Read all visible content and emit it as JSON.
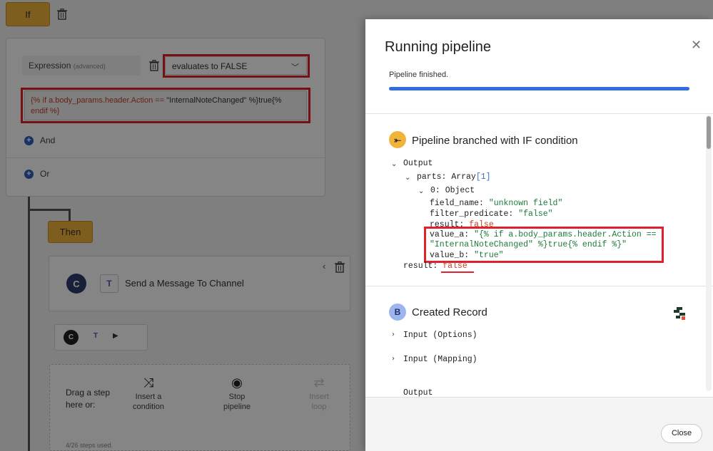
{
  "editor": {
    "if_label": "If",
    "then_label": "Then",
    "expression_label": "Expression",
    "expression_hint": "(advanced)",
    "condition_select": "evaluates to FALSE",
    "expression_code_prefix": "{% if a.body_params.header.Action == ",
    "expression_code_literal": "\"InternalNoteChanged\"",
    "expression_code_suffix": " %}true{%",
    "expression_code_line2": "endif %}",
    "and_label": "And",
    "or_label": "Or",
    "step_avatar": "C",
    "step_title": "Send a Message To Channel",
    "mini_avatar": "C",
    "drop_text": "Drag a step\nhere or:",
    "drop_actions": [
      {
        "label": "Insert a\ncondition",
        "icon": "⤨"
      },
      {
        "label": "Stop\npipeline",
        "icon": "◉"
      },
      {
        "label": "Insert\nloop",
        "icon": "⇄"
      }
    ],
    "steps_used": "4/26 steps used."
  },
  "modal": {
    "title": "Running pipeline",
    "status": "Pipeline finished.",
    "progress": 1.0,
    "section1": {
      "icon_letter": "⤜",
      "title": "Pipeline branched with IF condition",
      "output_label": "Output",
      "parts_label": "parts:",
      "parts_type": "Array",
      "parts_count": "[1]",
      "item_label": "0:",
      "item_type": "Object",
      "field_name_key": "field_name:",
      "field_name_val": "\"unknown field\"",
      "filter_predicate_key": "filter_predicate:",
      "filter_predicate_val": "\"false\"",
      "result_key": "result:",
      "result_val": "false",
      "value_a_key": "value_a:",
      "value_a_val_1": "\"{% if a.body_params.header.Action ==",
      "value_a_val_2": "\"InternalNoteChanged\" %}true{% endif %}\"",
      "value_b_key": "value_b:",
      "value_b_val": "\"true\"",
      "outer_result_key": "result:",
      "outer_result_val": "false"
    },
    "section2": {
      "icon_letter": "B",
      "title": "Created Record",
      "input_options": "Input (Options)",
      "input_mapping": "Input (Mapping)",
      "output_partial": "Output"
    },
    "close_label": "Close"
  },
  "colors": {
    "accent_blue": "#2f6ee0",
    "if_badge": "#f0b43a",
    "highlight_red": "#e0202a",
    "string_green": "#1e7a3c",
    "bool_red": "#c2422b"
  }
}
